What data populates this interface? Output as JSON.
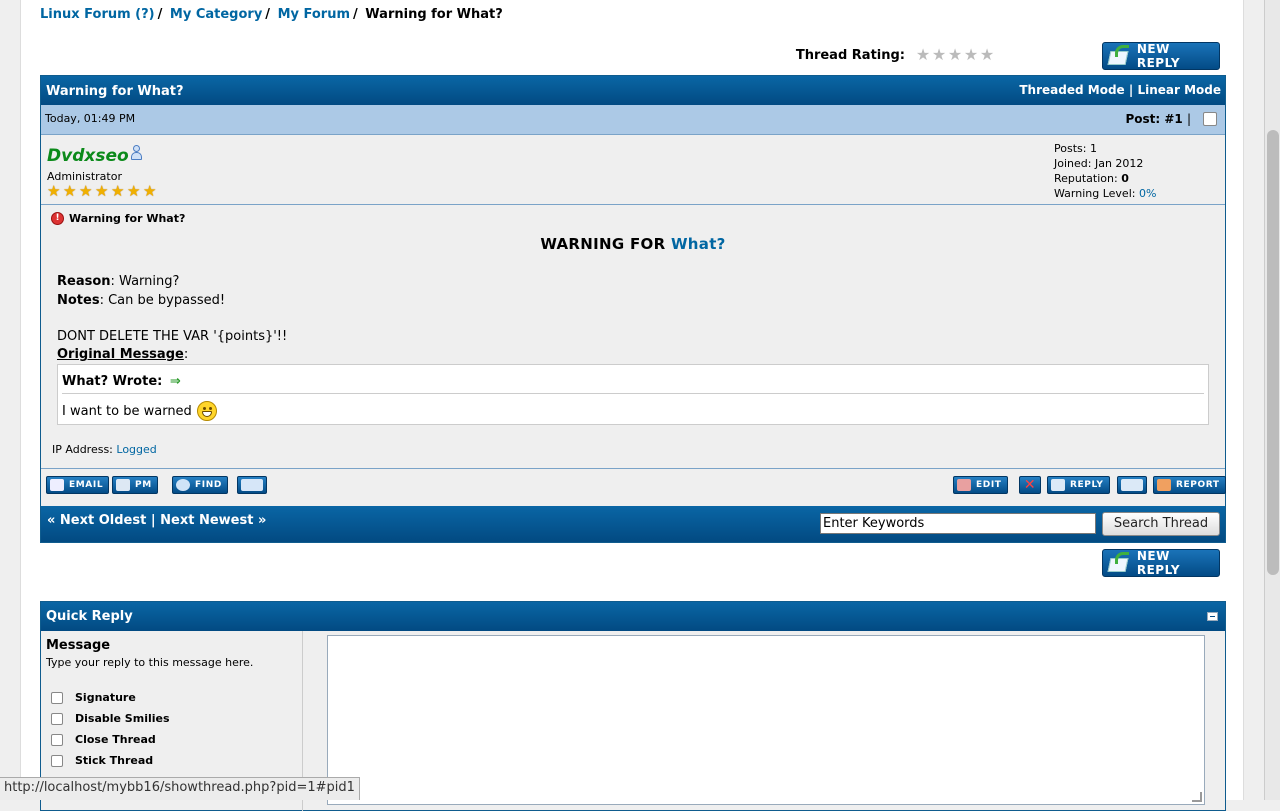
{
  "breadcrumb": {
    "items": [
      "Linux Forum (?)",
      "My Category",
      "My Forum"
    ],
    "current": "Warning for What?",
    "separator": "/"
  },
  "thread_rating": {
    "label": "Thread Rating:",
    "rating": 0,
    "max": 5
  },
  "new_reply_label": "NEW REPLY",
  "thread": {
    "title": "Warning for What?",
    "modes": {
      "threaded": "Threaded Mode",
      "separator": "|",
      "linear": "Linear Mode"
    },
    "post": {
      "date": "Today, 01:49 PM",
      "post_number_label": "Post:",
      "post_number": "#1",
      "post_number_sep": "|",
      "author": {
        "username": "Dvdxseo",
        "title": "Administrator",
        "star_count": 7,
        "stats": {
          "posts_label": "Posts:",
          "posts": "1",
          "joined_label": "Joined:",
          "joined": "Jan 2012",
          "reputation_label": "Reputation:",
          "reputation": "0",
          "warning_label": "Warning Level:",
          "warning": "0%"
        }
      },
      "subject": "Warning for What?",
      "headline_prefix": "WARNING FOR",
      "headline_link": "What?",
      "reason_label": "Reason",
      "reason": ": Warning?",
      "notes_label": "Notes",
      "notes": ": Can be bypassed!",
      "var_note": "DONT DELETE THE VAR '{points}'!!",
      "original_label": "Original Message",
      "original_colon": ":",
      "quote": {
        "header": "What? Wrote:",
        "arrow": "⇒",
        "text": "I want to be warned"
      },
      "ip_label": "IP Address:",
      "ip_value": "Logged"
    },
    "actions_left": [
      {
        "label": "EMAIL",
        "icon": "email-icon"
      },
      {
        "label": "PM",
        "icon": "pm-icon"
      },
      {
        "label": "FIND",
        "icon": "find-icon"
      },
      {
        "label": "",
        "icon": "add-buddy-icon"
      }
    ],
    "actions_right": [
      {
        "label": "EDIT",
        "icon": "edit-icon"
      },
      {
        "label": "",
        "icon": "delete-icon"
      },
      {
        "label": "REPLY",
        "icon": "reply-icon"
      },
      {
        "label": "",
        "icon": "multiquote-icon"
      },
      {
        "label": "REPORT",
        "icon": "report-icon"
      }
    ],
    "nav": {
      "prev": "« Next Oldest",
      "sep": "|",
      "next": "Next Newest »"
    },
    "search": {
      "value": "Enter Keywords",
      "button": "Search Thread"
    }
  },
  "quick_reply": {
    "title": "Quick Reply",
    "message_label": "Message",
    "message_hint": "Type your reply to this message here.",
    "options": [
      "Signature",
      "Disable Smilies",
      "Close Thread",
      "Stick Thread"
    ]
  },
  "status_url": "http://localhost/mybb16/showthread.php?pid=1#pid1",
  "colors": {
    "header_blue": "#034b86",
    "link_blue": "#0066a2",
    "username_green": "#0b8a1a",
    "date_bar": "#acc9e6"
  }
}
